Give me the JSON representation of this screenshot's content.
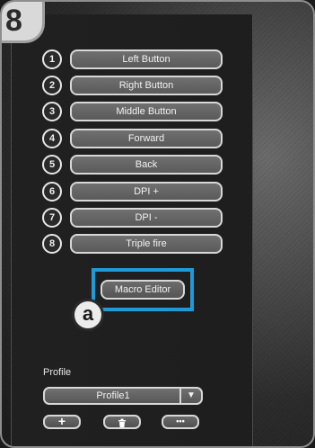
{
  "step_number": "8",
  "callout_letter": "a",
  "buttons": [
    {
      "num": "1",
      "label": "Left Button"
    },
    {
      "num": "2",
      "label": "Right Button"
    },
    {
      "num": "3",
      "label": "Middle Button"
    },
    {
      "num": "4",
      "label": "Forward"
    },
    {
      "num": "5",
      "label": "Back"
    },
    {
      "num": "6",
      "label": "DPI +"
    },
    {
      "num": "7",
      "label": "DPI -"
    },
    {
      "num": "8",
      "label": "Triple fire"
    }
  ],
  "macro_editor_label": "Macro Editor",
  "highlight_color": "#1f9ad6",
  "profile": {
    "label": "Profile",
    "selected": "Profile1",
    "dropdown_icon": "▼"
  },
  "actions": [
    {
      "name": "add",
      "icon": "+"
    },
    {
      "name": "delete",
      "icon": "trash"
    },
    {
      "name": "more",
      "icon": "•••"
    }
  ]
}
